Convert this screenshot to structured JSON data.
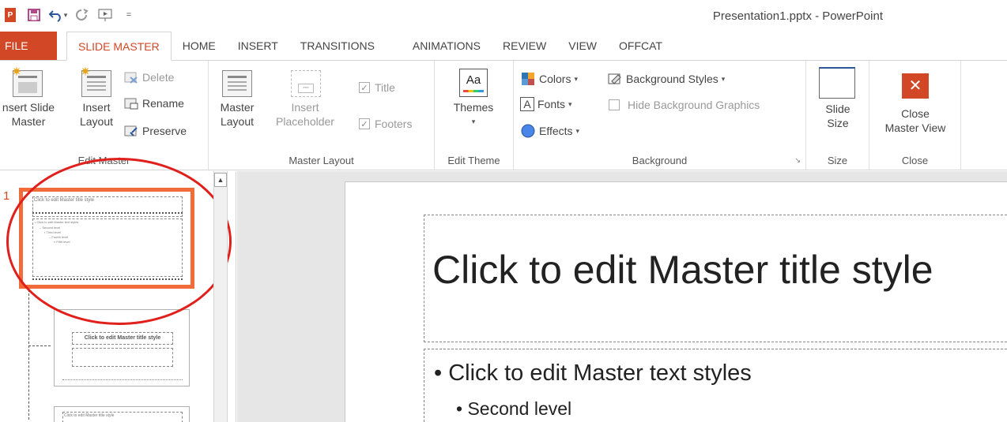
{
  "window": {
    "title": "Presentation1.pptx - PowerPoint"
  },
  "qat": {
    "icons": [
      "powerpoint-logo",
      "save-icon",
      "undo-icon",
      "redo-icon",
      "start-from-beginning-icon",
      "customize-qat-icon"
    ],
    "logo_text": "P"
  },
  "tabs": [
    "FILE",
    "SLIDE MASTER",
    "HOME",
    "INSERT",
    "TRANSITIONS",
    "ANIMATIONS",
    "REVIEW",
    "VIEW",
    "OFFCAT"
  ],
  "active_tab": "SLIDE MASTER",
  "ribbon": {
    "edit_master": {
      "label": "Edit Master",
      "insert_slide_master": "nsert Slide\nMaster",
      "insert_layout": "Insert\nLayout",
      "delete": "Delete",
      "rename": "Rename",
      "preserve": "Preserve"
    },
    "master_layout": {
      "label": "Master Layout",
      "master_layout_btn": "Master\nLayout",
      "insert_placeholder": "Insert\nPlaceholder",
      "title_check": "Title",
      "footers_check": "Footers"
    },
    "edit_theme": {
      "label": "Edit Theme",
      "themes": "Themes",
      "themes_icon_text": "Aa"
    },
    "background": {
      "label": "Background",
      "colors": "Colors",
      "fonts": "Fonts",
      "fonts_icon_text": "A",
      "effects": "Effects",
      "background_styles": "Background Styles",
      "hide_background_graphics": "Hide Background Graphics"
    },
    "size": {
      "label": "Size",
      "slide_size": "Slide\nSize"
    },
    "close": {
      "label": "Close",
      "close_master_view": "Close\nMaster View",
      "close_icon_text": "✕"
    }
  },
  "thumbnails": {
    "slide_number": "1",
    "master": {
      "title": "Click to edit Master title style",
      "body_l1": "• Click to edit Master text styles",
      "body_l2": "– Second level",
      "body_l3": "• Third level",
      "body_l4": "– Fourth level",
      "body_l5": "» Fifth level"
    },
    "layout1": {
      "title": "Click to edit Master title style"
    },
    "layout2": {
      "title": "Click to edit Master title style"
    }
  },
  "slide": {
    "title": "Click to edit Master title style",
    "body_l1": "• Click to edit Master text styles",
    "body_l2": "• Second level"
  },
  "colors": {
    "accent": "#d24726",
    "selection_border": "#f26b3a",
    "annotation_ellipse": "#e0201c"
  }
}
